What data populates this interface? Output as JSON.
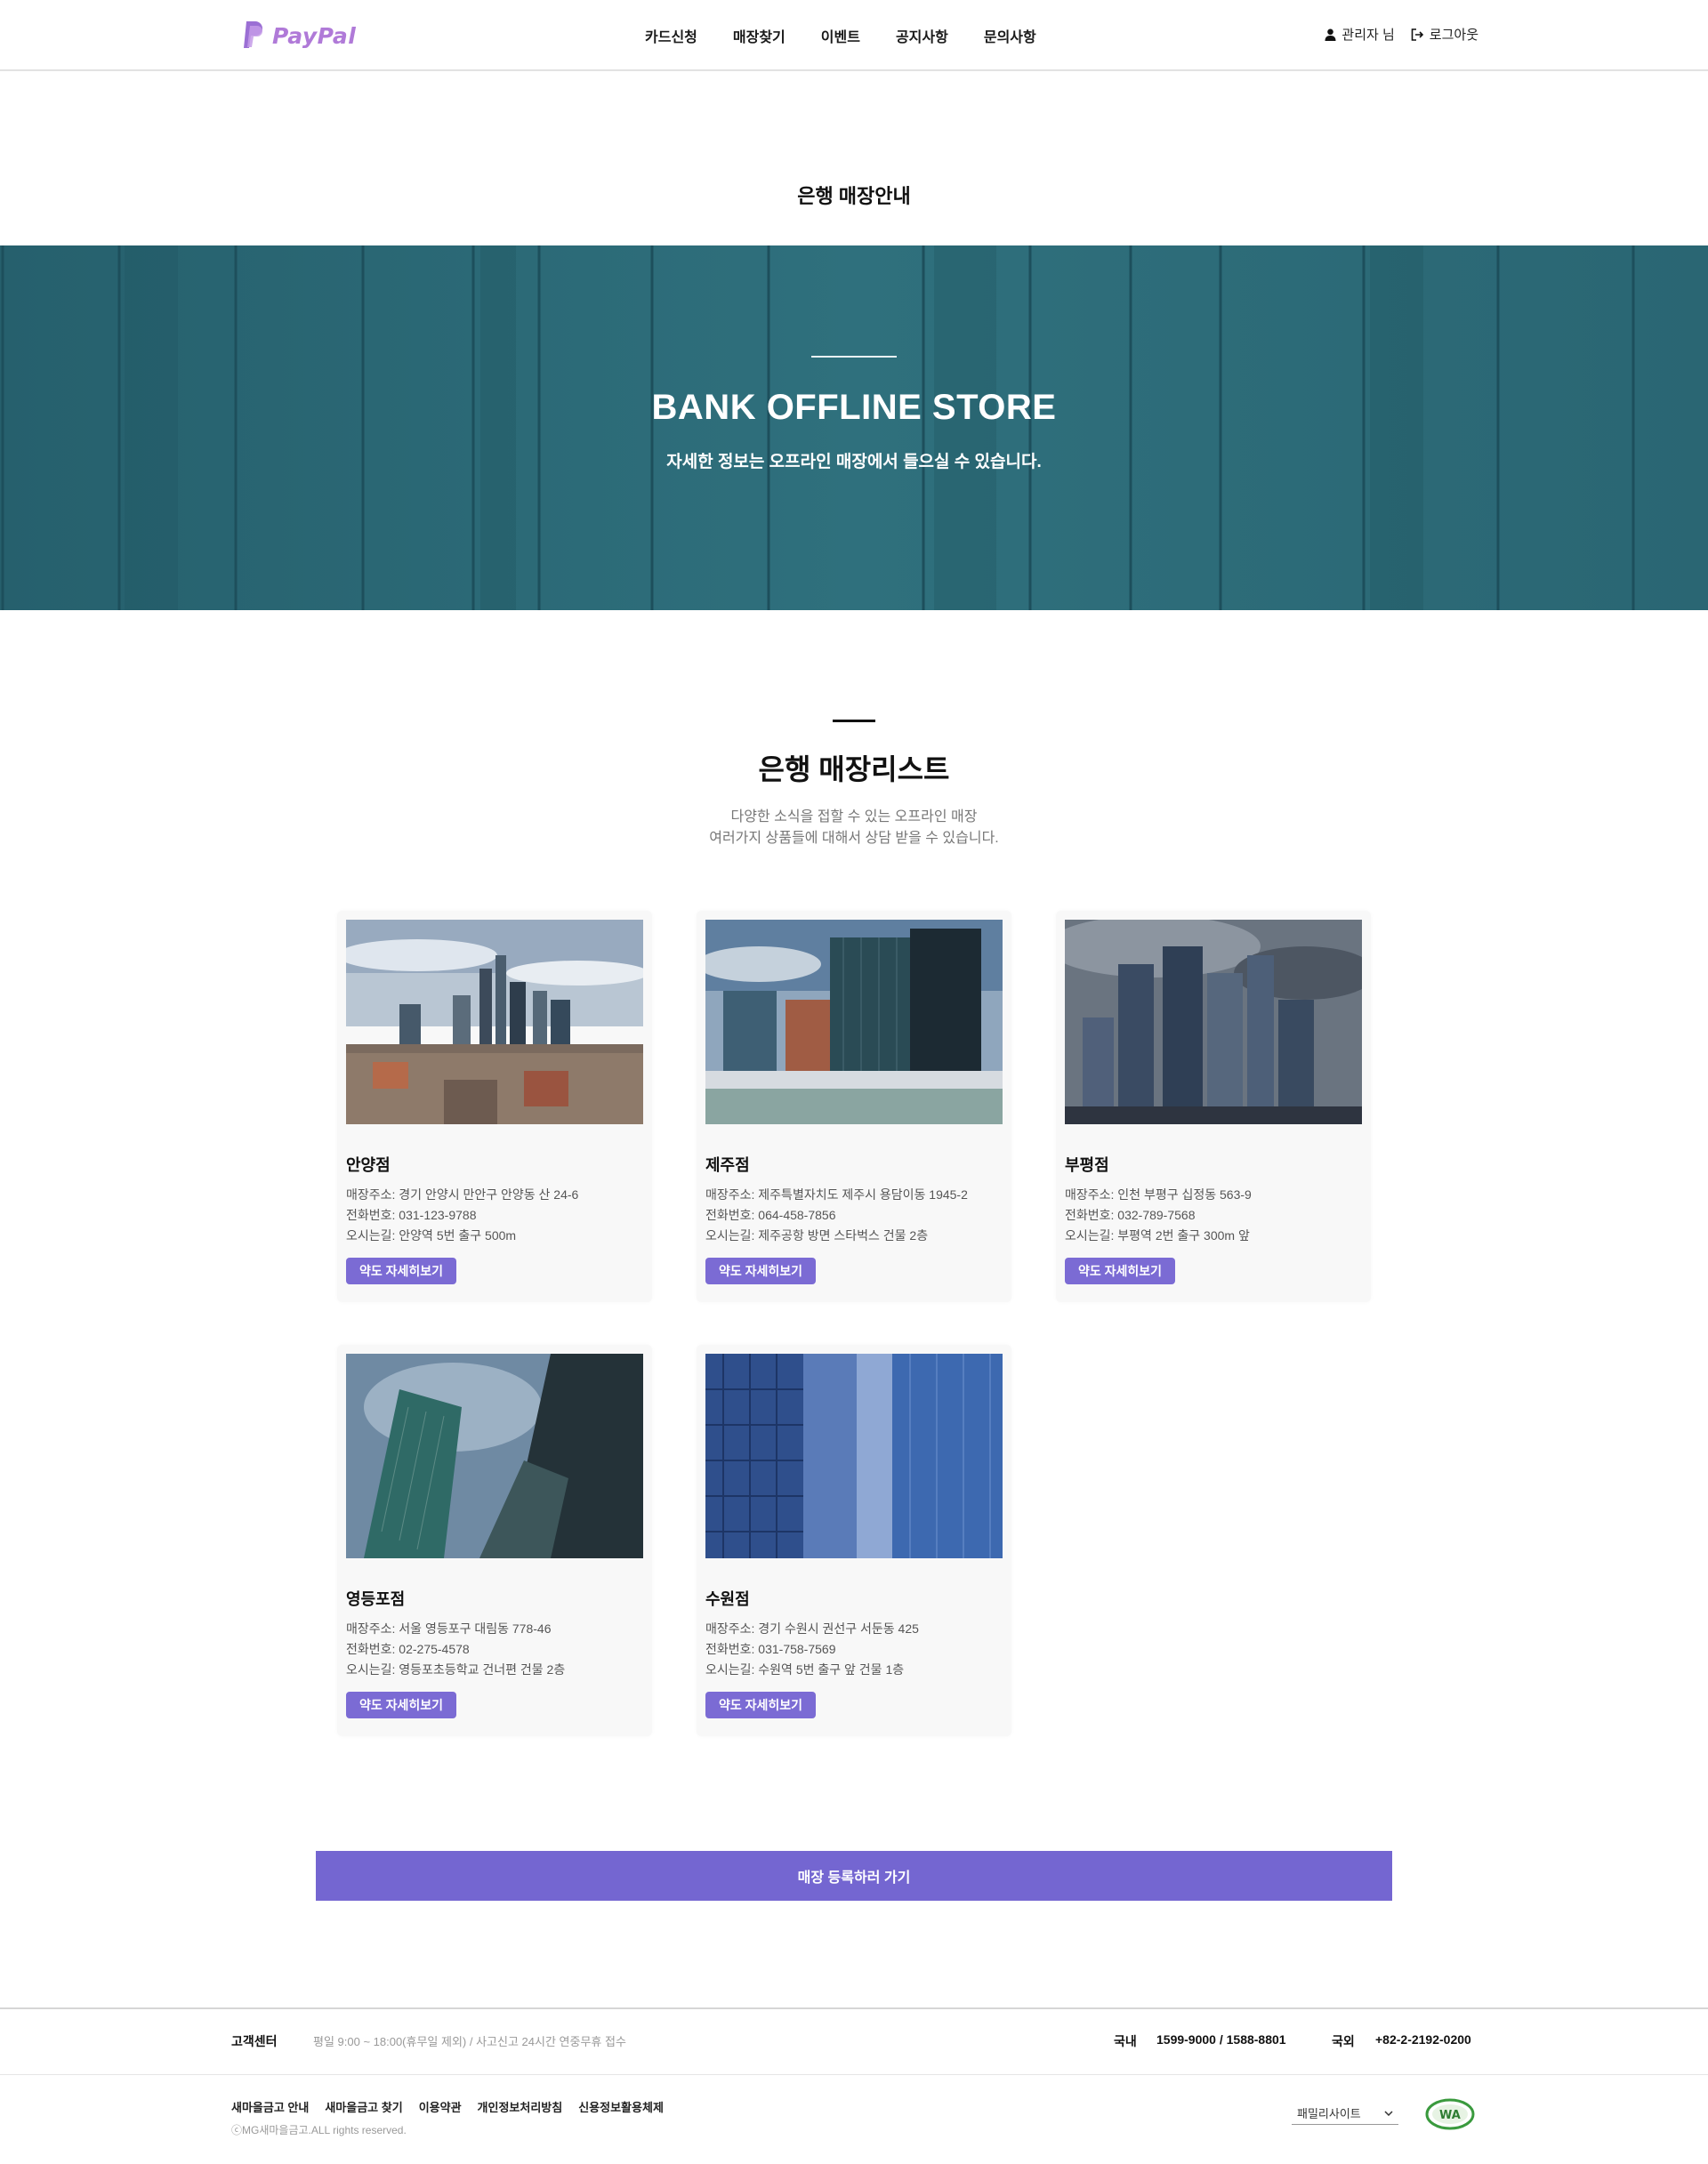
{
  "header": {
    "logo_text": "PayPal",
    "nav": [
      "카드신청",
      "매장찾기",
      "이벤트",
      "공지사항",
      "문의사항"
    ],
    "user_label": "관리자 님",
    "logout_label": "로그아웃"
  },
  "page_title": "은행 매장안내",
  "hero": {
    "title": "BANK OFFLINE STORE",
    "subtitle": "자세한 정보는 오프라인 매장에서 들으실 수 있습니다."
  },
  "section": {
    "title": "은행 매장리스트",
    "desc_line1": "다양한 소식을 접할 수 있는 오프라인 매장",
    "desc_line2": "여러가지 상품들에 대해서 상담 받을 수 있습니다."
  },
  "stores": [
    {
      "name": "안양점",
      "address": "매장주소: 경기 안양시 만안구 안양동 산 24-6",
      "phone": "전화번호: 031-123-9788",
      "directions": "오시는길: 안양역 5번 출구 500m",
      "button": "약도 자세히보기"
    },
    {
      "name": "제주점",
      "address": "매장주소: 제주특별자치도 제주시 용담이동 1945-2",
      "phone": "전화번호: 064-458-7856",
      "directions": "오시는길: 제주공항 방면 스타벅스 건물 2층",
      "button": "약도 자세히보기"
    },
    {
      "name": "부평점",
      "address": "매장주소: 인천 부평구 십정동 563-9",
      "phone": "전화번호: 032-789-7568",
      "directions": "오시는길: 부평역 2번 출구 300m 앞",
      "button": "약도 자세히보기"
    },
    {
      "name": "영등포점",
      "address": "매장주소: 서울 영등포구 대림동 778-46",
      "phone": "전화번호: 02-275-4578",
      "directions": "오시는길: 영등포초등학교 건너편 건물 2층",
      "button": "약도 자세히보기"
    },
    {
      "name": "수원점",
      "address": "매장주소: 경기 수원시 권선구 서둔동 425",
      "phone": "전화번호: 031-758-7569",
      "directions": "오시는길: 수원역 5번 출구 앞 건물 1층",
      "button": "약도 자세히보기"
    }
  ],
  "register_button": "매장 등록하러 가기",
  "footer": {
    "cs_label": "고객센터",
    "cs_hours": "평일 9:00 ~ 18:00(휴무일 제외) / 사고신고 24시간 연중무휴 접수",
    "domestic_label": "국내",
    "domestic_number": "1599-9000 / 1588-8801",
    "intl_label": "국외",
    "intl_number": "+82-2-2192-0200",
    "links": [
      "새마을금고 안내",
      "새마을금고 찾기",
      "이용약관",
      "개인정보처리방침",
      "신용정보활용체제"
    ],
    "copyright": "ⓒMG새마을금고.ALL rights reserved.",
    "family_site": "패밀리사이트",
    "wa_mark": "WA"
  },
  "colors": {
    "accent": "#7466d1",
    "button": "#7b6bd4",
    "hero": "#2c6a77",
    "logo": "#b07ad8"
  }
}
